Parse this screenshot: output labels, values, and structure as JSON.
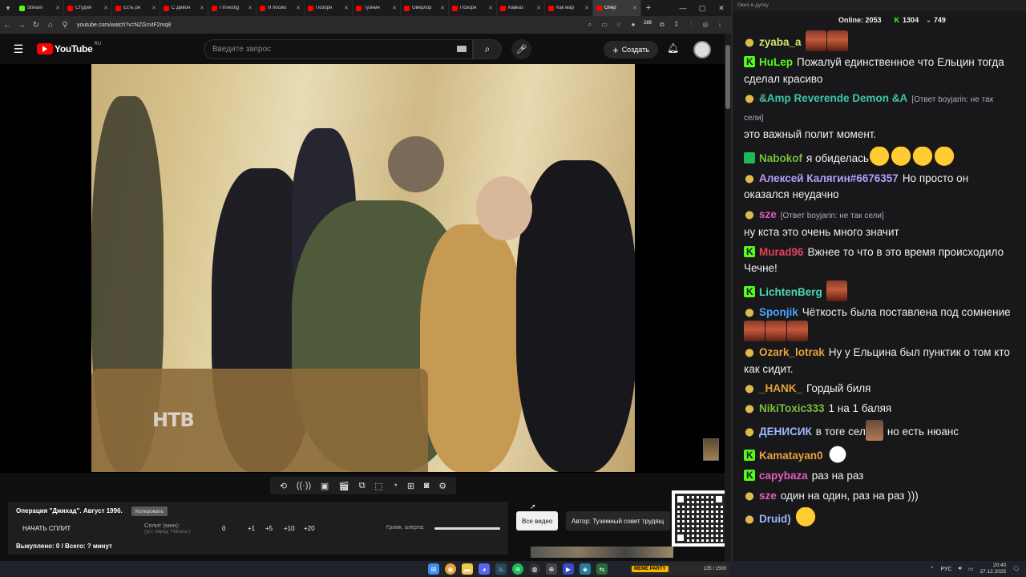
{
  "browser": {
    "tabs": [
      {
        "label": "Stream",
        "color": "#53fc18"
      },
      {
        "label": "Студия",
        "color": "#ff0000"
      },
      {
        "label": "Есть ре",
        "color": "#ff0000"
      },
      {
        "label": "С Девон",
        "color": "#ff0000"
      },
      {
        "label": "I Investig",
        "color": "#ff0000"
      },
      {
        "label": "Я посмо",
        "color": "#ff0000"
      },
      {
        "label": "Позорн",
        "color": "#ff0000"
      },
      {
        "label": "Туземн",
        "color": "#ff0000"
      },
      {
        "label": "Оверлор",
        "color": "#ff0000"
      },
      {
        "label": "Позорн",
        "color": "#ff0000"
      },
      {
        "label": "Кавказ",
        "color": "#ff0000"
      },
      {
        "label": "Как мар",
        "color": "#ff0000"
      },
      {
        "label": "Опер",
        "color": "#ff0000"
      }
    ],
    "url": "youtube.com/watch?v=NZGcvtF2mq8",
    "notification_count": "289"
  },
  "youtube": {
    "logo_text": "YouTube",
    "region": "RU",
    "search_placeholder": "Введите запрос",
    "create_label": "Создать"
  },
  "video": {
    "overlay_logo": "НТВ"
  },
  "split_panel": {
    "title": "Операция \"Джихад\". Август 1996.",
    "copy_label": "Копировать",
    "start_label": "НАЧАТЬ СПЛИТ",
    "split_label": "Сплит (мин):",
    "split_hint": "(уст. перед \"Начать\")",
    "values": [
      "0",
      "+1",
      "+5",
      "+10",
      "+20"
    ],
    "volume_label": "Громк. алерта:",
    "status": "Выкуплено: 0 / Всего: ? минут"
  },
  "below_video": {
    "all_videos_label": "Все видео",
    "author_label": "Автор: Туземный совет трудящ"
  },
  "chat": {
    "window_title": "Окно в дупку",
    "online_label": "Online:",
    "online_count": "2053",
    "kick_count": "1304",
    "helmet_count": "749",
    "messages": [
      {
        "badge": "helmet",
        "user": "zyaba_a",
        "color": "#cfe36a",
        "reply": "",
        "text": "",
        "emotes": [
          "face",
          "face"
        ]
      },
      {
        "badge": "kick",
        "user": "HuLep",
        "color": "#53fc18",
        "reply": "",
        "text": "Пожалуй единственное что Ельцин тогда сделал красиво",
        "emotes": []
      },
      {
        "badge": "helmet",
        "user": "&Amp Reverende Demon &A",
        "color": "#3ec7a6",
        "reply": "[Ответ boyjarin: не так сели]",
        "text": "это важный полит момент.",
        "emotes": []
      },
      {
        "badge": "shield",
        "user": "Nabokof",
        "color": "#7bbf3a",
        "reply": "",
        "text": "я обиделась",
        "emotes": [
          "laugh",
          "laugh",
          "laugh",
          "laugh"
        ]
      },
      {
        "badge": "helmet",
        "user": "Алексей Калягин#6676357",
        "color": "#b79cff",
        "reply": "",
        "text": "Но просто он оказался неудачно",
        "emotes": []
      },
      {
        "badge": "helmet",
        "user": "sze",
        "color": "#e05fb8",
        "reply": "[Ответ boyjarin: не так сели]",
        "text": "ну кста это очень много значит",
        "emotes": []
      },
      {
        "badge": "kick",
        "user": "Murad96",
        "color": "#e0445a",
        "reply": "",
        "text": "Вжнее то что в это время происходило Чечне!",
        "emotes": []
      },
      {
        "badge": "kick",
        "user": "LichtenBerg",
        "color": "#4ad6b4",
        "reply": "",
        "text": "",
        "emotes": [
          "face"
        ]
      },
      {
        "badge": "helmet",
        "user": "Sponjik",
        "color": "#4aa3ff",
        "reply": "",
        "text": "Чёткость была поставлена под сомнение",
        "emotes": [
          "face",
          "face",
          "face"
        ]
      },
      {
        "badge": "helmet",
        "user": "Ozark_lotrak",
        "color": "#e8a13a",
        "reply": "",
        "text": "Ну у Ельцина был пунктик о том кто как сидит.",
        "emotes": []
      },
      {
        "badge": "helmet",
        "user": "_HANK_",
        "color": "#e8a13a",
        "reply": "",
        "text": "Гордый биля",
        "emotes": []
      },
      {
        "badge": "helmet",
        "user": "NikiToxic333",
        "color": "#7bbf3a",
        "reply": "",
        "text": "1 на 1 баляя",
        "emotes": []
      },
      {
        "badge": "helmet",
        "user": "ДЕНИСИК",
        "color": "#9fb6ff",
        "reply": "",
        "text": "в тоге сел",
        "emotes": [
          "photo"
        ],
        "tail": "но есть нюанс"
      },
      {
        "badge": "kick",
        "user": "Kamatayan0",
        "color": "#e8a13a",
        "reply": "",
        "text": "",
        "emotes": [
          "white"
        ]
      },
      {
        "badge": "kick",
        "user": "capybaza",
        "color": "#e05fb8",
        "reply": "",
        "text": "раз на раз",
        "emotes": []
      },
      {
        "badge": "helmet",
        "user": "sze",
        "color": "#e05fb8",
        "reply": "",
        "text": "один на один, раз на раз )))",
        "emotes": []
      },
      {
        "badge": "helmet",
        "user": "Druid)",
        "color": "#9fb6ff",
        "reply": "",
        "text": "",
        "emotes": [
          "laugh"
        ]
      }
    ]
  },
  "taskbar": {
    "meme_party_label": "MEME PARTY",
    "meme_party_progress": "135 / 1500",
    "language": "РУС",
    "time": "20:40",
    "date": "27.12.2025"
  }
}
